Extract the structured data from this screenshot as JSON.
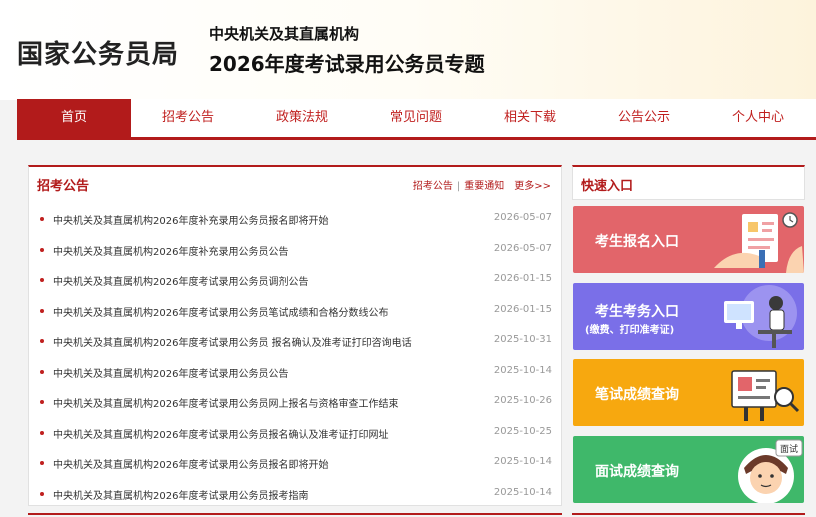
{
  "header": {
    "logo": "国家公务员局",
    "subtitle1": "中央机关及其直属机构",
    "subtitle2": "2026年度考试录用公务员专题"
  },
  "nav": {
    "items": [
      "首页",
      "招考公告",
      "政策法规",
      "常见问题",
      "相关下载",
      "公告公示",
      "个人中心"
    ]
  },
  "announcements": {
    "title": "招考公告",
    "link1": "招考公告",
    "link2": "重要通知",
    "more": "更多>>",
    "separator": "|",
    "items": [
      {
        "title": "中央机关及其直属机构2026年度补充录用公务员报名即将开始",
        "date": "2026-05-07"
      },
      {
        "title": "中央机关及其直属机构2026年度补充录用公务员公告",
        "date": "2026-05-07"
      },
      {
        "title": "中央机关及其直属机构2026年度考试录用公务员调剂公告",
        "date": "2026-01-15"
      },
      {
        "title": "中央机关及其直属机构2026年度考试录用公务员笔试成绩和合格分数线公布",
        "date": "2026-01-15"
      },
      {
        "title": "中央机关及其直属机构2026年度考试录用公务员 报名确认及准考证打印咨询电话",
        "date": "2025-10-31"
      },
      {
        "title": "中央机关及其直属机构2026年度考试录用公务员公告",
        "date": "2025-10-14"
      },
      {
        "title": "中央机关及其直属机构2026年度考试录用公务员网上报名与资格审查工作结束",
        "date": "2025-10-26"
      },
      {
        "title": "中央机关及其直属机构2026年度考试录用公务员报名确认及准考证打印网址",
        "date": "2025-10-25"
      },
      {
        "title": "中央机关及其直属机构2026年度考试录用公务员报名即将开始",
        "date": "2025-10-14"
      },
      {
        "title": "中央机关及其直属机构2026年度考试录用公务员报考指南",
        "date": "2025-10-14"
      }
    ]
  },
  "quick": {
    "title": "快速入口",
    "card1": "考生报名入口",
    "card2": "考生考务入口",
    "card2_sub": "(缴费、打印准考证)",
    "card3": "笔试成绩查询",
    "card4": "面试成绩查询",
    "card4_badge": "面试"
  },
  "colors": {
    "brand": "#b21b1b",
    "card1": "#e2656a",
    "card2": "#7a6fe8",
    "card3": "#f7a80f",
    "card4": "#3fb86a"
  }
}
